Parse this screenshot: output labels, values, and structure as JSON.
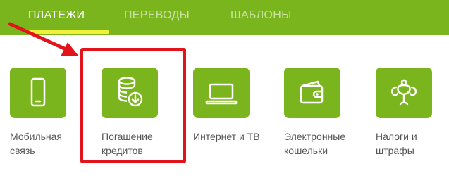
{
  "tabs": [
    {
      "label": "ПЛАТЕЖИ",
      "active": true
    },
    {
      "label": "ПЕРЕВОДЫ",
      "active": false
    },
    {
      "label": "ШАБЛОНЫ",
      "active": false
    }
  ],
  "categories": [
    {
      "icon": "mobile-phone-icon",
      "line1": "Мобильная",
      "line2": "связь"
    },
    {
      "icon": "coins-download-icon",
      "line1": "Погашение",
      "line2": "кредитов"
    },
    {
      "icon": "tv-monitor-icon",
      "line1": "Интернет и ТВ",
      "line2": ""
    },
    {
      "icon": "wallet-icon",
      "line1": "Электронные",
      "line2": "кошельки"
    },
    {
      "icon": "emblem-icon",
      "line1": "Налоги и",
      "line2": "штрафы"
    }
  ],
  "colors": {
    "brand_green": "#7ab51d",
    "tab_underline": "#f0ef3a",
    "highlight_red": "#e2141b"
  }
}
